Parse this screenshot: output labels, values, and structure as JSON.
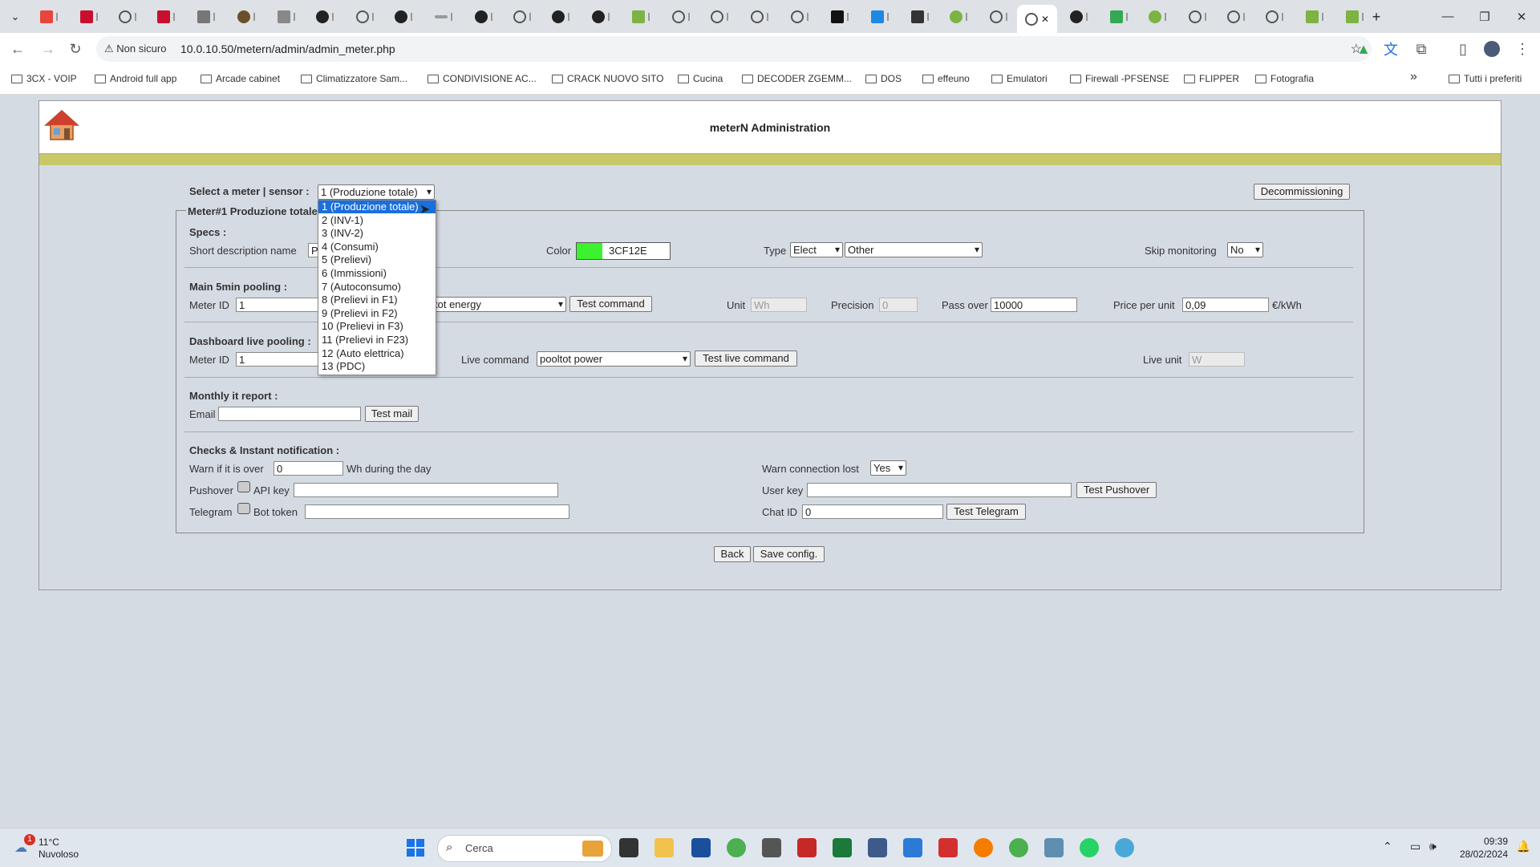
{
  "browser": {
    "security_label": "Non sicuro",
    "url": "10.0.10.50/metern/admin/admin_meter.php",
    "new_tab": "+",
    "minimize": "—",
    "restore": "❐",
    "close": "✕"
  },
  "bookmarks": [
    "3CX - VOIP",
    "Android full app",
    "Arcade cabinet",
    "Climatizzatore Sam...",
    "CONDIVISIONE AC...",
    "CRACK NUOVO SITO",
    "Cucina",
    "DECODER ZGEMM...",
    "DOS",
    "effeuno",
    "Emulatori",
    "Firewall -PFSENSE",
    "FLIPPER",
    "Fotografia"
  ],
  "bookmarks_more": "»",
  "bookmarks_all": "Tutti i preferiti",
  "page": {
    "title": "meterN Administration",
    "select_meter_label": "Select a meter | sensor :",
    "selected_meter": "1 (Produzione totale)",
    "decommissioning": "Decommissioning",
    "legend": "Meter#1 Produzione totale",
    "specs": {
      "heading": "Specs :",
      "short_desc_label": "Short description name",
      "short_desc_value": "P",
      "color_label": "Color",
      "color_value": "3CF12E",
      "color_swatch": "#3CF12E",
      "type_label": "Type",
      "type_value": "Elect",
      "type2_value": "Other",
      "skip_label": "Skip monitoring",
      "skip_value": "No"
    },
    "main": {
      "heading": "Main 5min pooling :",
      "meter_id_label": "Meter ID",
      "meter_id_value": "1",
      "command_value": "tot energy",
      "test_command": "Test command",
      "unit_label": "Unit",
      "unit_value": "Wh",
      "precision_label": "Precision",
      "precision_value": "0",
      "pass_over_label": "Pass over",
      "pass_over_value": "10000",
      "price_label": "Price per unit",
      "price_value": "0,09",
      "price_unit": "€/kWh"
    },
    "live": {
      "heading": "Dashboard live pooling :",
      "meter_id_label": "Meter ID",
      "meter_id_value": "1",
      "live_command_label": "Live command",
      "live_command_value": "pooltot power",
      "test_live": "Test live command",
      "live_unit_label": "Live unit",
      "live_unit_value": "W"
    },
    "monthly": {
      "heading": "Monthly it report :",
      "email_label": "Email",
      "test_mail": "Test mail"
    },
    "checks": {
      "heading": "Checks & Instant notification :",
      "warn_label": "Warn if it is over",
      "warn_value": "0",
      "warn_suffix": "Wh during the day",
      "warn_conn_label": "Warn connection lost",
      "warn_conn_value": "Yes",
      "pushover_label": "Pushover",
      "api_key_label": "API key",
      "user_key_label": "User key",
      "test_pushover": "Test Pushover",
      "telegram_label": "Telegram",
      "bot_token_label": "Bot token",
      "chat_id_label": "Chat ID",
      "chat_id_value": "0",
      "test_telegram": "Test Telegram"
    },
    "back": "Back",
    "save": "Save config.",
    "dropdown_options": [
      "1 (Produzione totale)",
      "2 (INV-1)",
      "3 (INV-2)",
      "4 (Consumi)",
      "5 (Prelievi)",
      "6 (Immissioni)",
      "7 (Autoconsumo)",
      "8 (Prelievi in F1)",
      "9 (Prelievi in F2)",
      "10 (Prelievi in F3)",
      "11 (Prelievi in F23)",
      "12 (Auto elettrica)",
      "13 (PDC)"
    ]
  },
  "taskbar": {
    "weather_temp": "11°C",
    "weather_desc": "Nuvoloso",
    "weather_badge": "1",
    "search": "Cerca",
    "time": "09:39",
    "date": "28/02/2024"
  }
}
